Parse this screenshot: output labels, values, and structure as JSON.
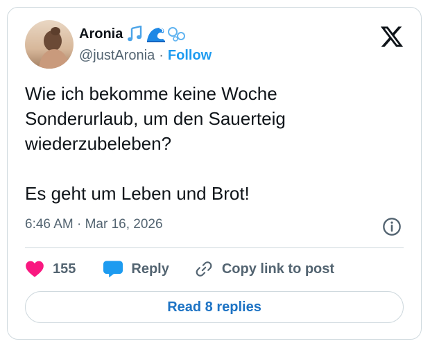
{
  "author": {
    "display_name": "Aronia",
    "name_emojis": [
      "musical-notes-icon",
      "wave-icon",
      "bubbles-icon"
    ],
    "handle": "@justAronia",
    "separator": "·",
    "follow_label": "Follow",
    "avatar_icon": "avatar-photo"
  },
  "tweet": {
    "paragraphs": [
      "Wie ich bekomme keine Woche Sonderurlaub, um den Sauerteig wiederzubeleben?",
      "Es geht um Leben und Brot!"
    ],
    "timestamp": "6:46 AM · Mar 16, 2026"
  },
  "actions": {
    "like_count": "155",
    "reply_label": "Reply",
    "copy_label": "Copy link to post"
  },
  "footer": {
    "read_replies_label": "Read 8 replies"
  },
  "colors": {
    "accent": "#1d9bf0",
    "like": "#f91880",
    "muted": "#536471",
    "border": "#cfd9de"
  }
}
